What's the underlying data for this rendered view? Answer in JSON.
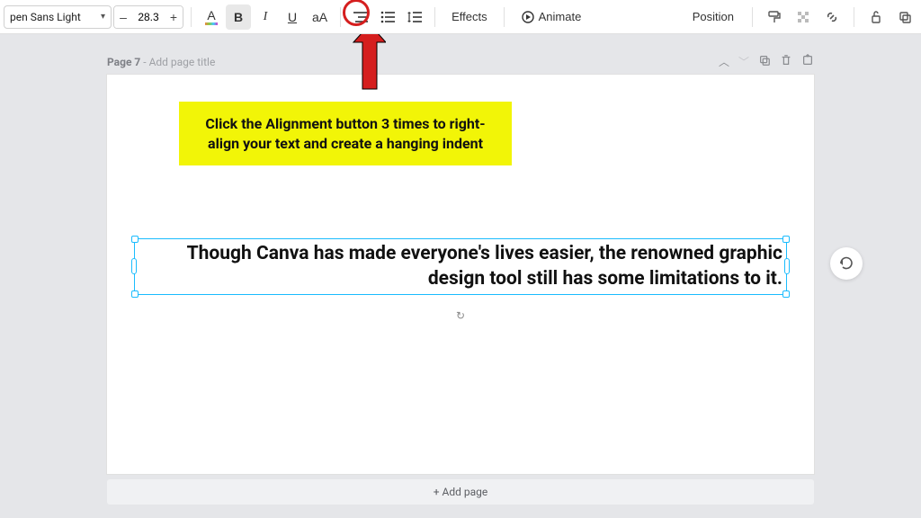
{
  "toolbar": {
    "font_name": "pen Sans Light",
    "font_size": "28.3",
    "text_color_letter": "A",
    "bold": "B",
    "italic": "I",
    "underline": "U",
    "uppercase": "aA",
    "effects_label": "Effects",
    "animate_label": "Animate",
    "position_label": "Position"
  },
  "page_header": {
    "page_label": "Page 7",
    "placeholder": " - Add page title"
  },
  "callout": {
    "text": "Click the Alignment button 3 times to right-align your text and create a hanging indent"
  },
  "textbox": {
    "content": "Though Canva has made everyone's lives easier, the renowned graphic design tool still has some limitations to it."
  },
  "footer": {
    "add_page_label": "+ Add page"
  }
}
